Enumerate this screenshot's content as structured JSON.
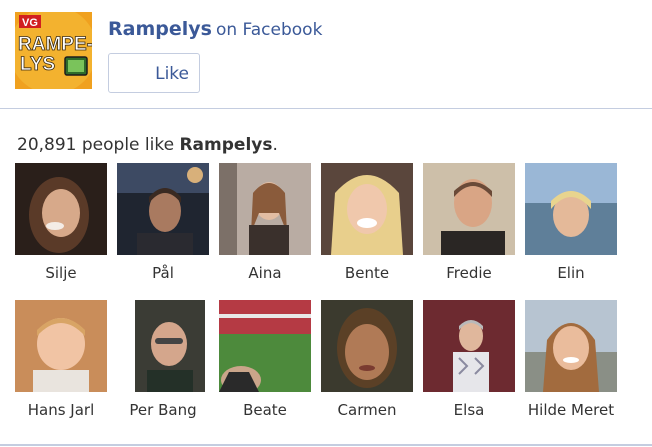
{
  "header": {
    "logo_alt": "Rampelys logo",
    "logo_text_top": "VG",
    "logo_text_line1": "RAMPE-",
    "logo_text_line2": "LYS",
    "page_name": "Rampelys",
    "on_facebook": "on Facebook",
    "like_label": "Like"
  },
  "summary": {
    "count": "20,891",
    "text_before": "people like",
    "page_name": "Rampelys",
    "text_after": "."
  },
  "colors": {
    "link": "#3b5998",
    "border": "#c4cde0",
    "logo_orange": "#f0a11f"
  },
  "faces": [
    {
      "name": "Silje"
    },
    {
      "name": "Pål"
    },
    {
      "name": "Aina"
    },
    {
      "name": "Bente"
    },
    {
      "name": "Fredie"
    },
    {
      "name": "Elin"
    },
    {
      "name": "Hans Jarl"
    },
    {
      "name": "Per Bang"
    },
    {
      "name": "Beate"
    },
    {
      "name": "Carmen"
    },
    {
      "name": "Elsa"
    },
    {
      "name": "Hilde Meret"
    }
  ]
}
